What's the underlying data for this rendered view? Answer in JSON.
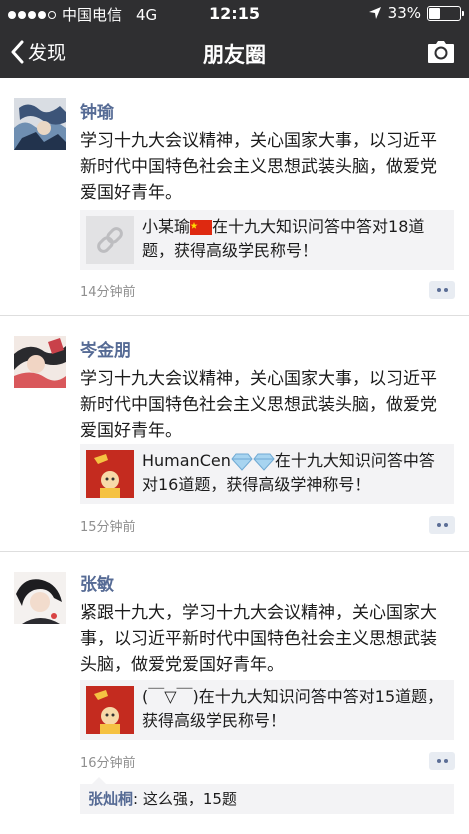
{
  "status_bar": {
    "carrier": "中国电信",
    "network": "4G",
    "time": "12:15",
    "battery": "33%",
    "battery_level": 0.33
  },
  "nav": {
    "back_label": "发现",
    "title": "朋友圈"
  },
  "posts": [
    {
      "author": "钟瑜",
      "text": "学习十九大会议精神，关心国家大事，以习近平新时代中国特色社会主义思想武装头脑，做爱党爱国好青年。",
      "link_prefix": "小某瑜",
      "link_suffix": "在十九大知识问答中答对18道题，获得高级学民称号！",
      "time": "14分钟前"
    },
    {
      "author": "岑金朋",
      "text": "学习十九大会议精神，关心国家大事，以习近平新时代中国特色社会主义思想武装头脑，做爱党爱国好青年。",
      "link_prefix": "HumanCen",
      "link_suffix": "在十九大知识问答中答对16道题，获得高级学神称号！",
      "time": "15分钟前"
    },
    {
      "author": "张敏",
      "text": "紧跟十九大，学习十九大会议精神，关心国家大事，以习近平新时代中国特色社会主义思想武装头脑，做爱党爱国好青年。",
      "link_text": "(￣▽￣)在十九大知识问答中答对15道题，获得高级学民称号！",
      "time": "16分钟前",
      "comment": {
        "author": "张灿桐",
        "separator": ": ",
        "text": "这么强，15题"
      }
    }
  ],
  "icons": {
    "back": "chevron-left-icon",
    "camera": "camera-icon",
    "location": "location-arrow-icon",
    "link": "link-icon",
    "flag": "china-flag-icon",
    "diamond": "diamond-icon",
    "comment": "comment-dots-icon"
  },
  "colors": {
    "nav_bg": "#2f2f31",
    "author_name": "#566b95",
    "card_bg": "#f3f3f5",
    "time_text": "#8f8f8f"
  }
}
